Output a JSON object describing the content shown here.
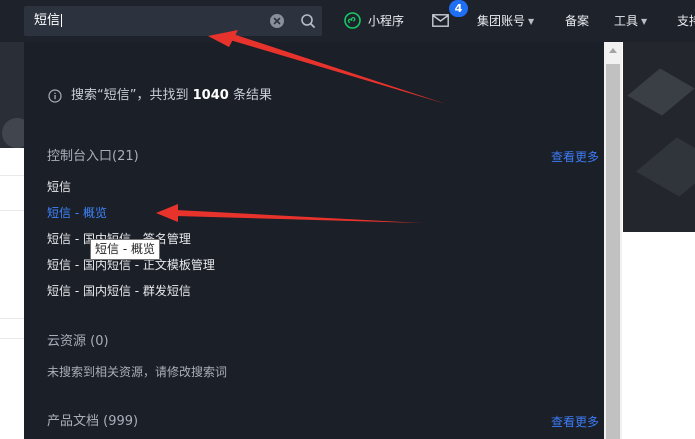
{
  "topbar": {
    "search_value": "短信",
    "nav": {
      "mini_program": "小程序",
      "mail_badge": "4",
      "group_account": "集团账号",
      "beian": "备案",
      "tools": "工具",
      "support": "支持"
    }
  },
  "dropdown": {
    "summary_prefix": "搜索“短信”，共找到",
    "summary_count": "1040",
    "summary_suffix": "条结果",
    "console": {
      "title": "控制台入口(21)",
      "more": "查看更多",
      "items": [
        "短信",
        "短信 - 概览",
        "短信 - 国内短信 - 签名管理",
        "短信 - 国内短信 - 正文模板管理",
        "短信 - 国内短信 - 群发短信"
      ]
    },
    "cloud": {
      "title": "云资源 (0)",
      "empty": "未搜索到相关资源，请修改搜索词"
    },
    "docs": {
      "title": "产品文档 (999)",
      "more": "查看更多"
    }
  },
  "tooltip": {
    "text": "短信 - 概览"
  },
  "colors": {
    "topbar_bg": "#1e222b",
    "dropdown_bg": "#1b1f27",
    "link_blue": "#3d7cf7",
    "annotation_red": "#e8332d",
    "badge_blue": "#1f6ff5"
  }
}
